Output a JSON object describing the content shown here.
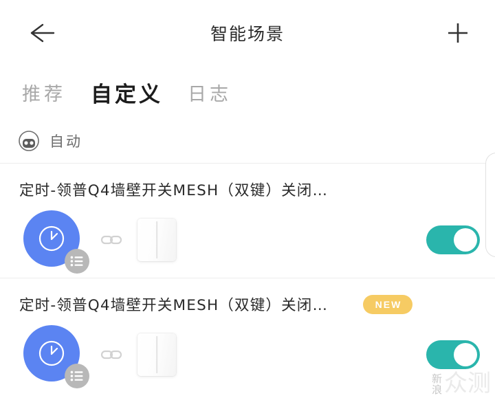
{
  "header": {
    "title": "智能场景",
    "back_icon": "arrow-left-icon",
    "add_icon": "plus-icon"
  },
  "tabs": [
    {
      "label": "推荐",
      "active": false
    },
    {
      "label": "自定义",
      "active": true
    },
    {
      "label": "日志",
      "active": false
    }
  ],
  "section": {
    "icon": "robot-icon",
    "label": "自动"
  },
  "scenes": [
    {
      "title": "定时-领普Q4墙壁开关MESH（双键）关闭…",
      "badge": "",
      "trigger_icon": "clock-icon",
      "list_badge_icon": "list-icon",
      "link_icon": "link-icon",
      "device_icon": "wall-switch-image",
      "toggle_on": true
    },
    {
      "title": "定时-领普Q4墙壁开关MESH（双键）关闭…",
      "badge": "NEW",
      "trigger_icon": "clock-icon",
      "list_badge_icon": "list-icon",
      "link_icon": "link-icon",
      "device_icon": "wall-switch-image",
      "toggle_on": true
    }
  ],
  "watermark": {
    "small_top": "新",
    "small_bottom": "浪",
    "big": "众测"
  },
  "colors": {
    "toggle_on": "#2ab5ac",
    "trigger_blue": "#5b84f2",
    "badge_yellow": "#f6cb63",
    "text_primary": "#2a2a2a",
    "text_muted": "#a8a8a8"
  }
}
